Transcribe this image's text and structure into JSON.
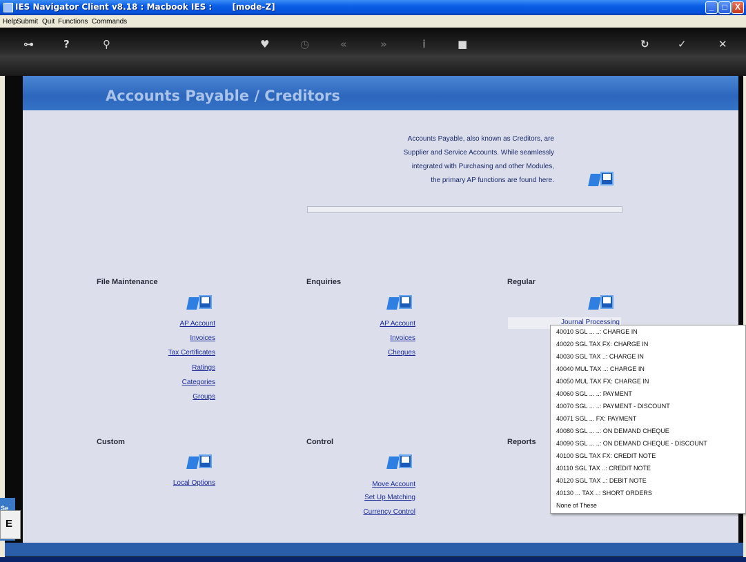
{
  "window": {
    "title": "IES Navigator Client v8.18 : Macbook IES :       [mode-Z]",
    "controls": [
      "_",
      "□",
      "X"
    ]
  },
  "menubar": [
    "Help",
    "Submit",
    "Quit",
    "Functions",
    "Commands"
  ],
  "toolbar": {
    "icons": [
      "key-icon",
      "help-icon",
      "search-icon",
      "heart-icon",
      "clock-icon",
      "rewind-icon",
      "forward-icon",
      "info-icon",
      "stop-icon",
      "refresh-icon",
      "ok-icon",
      "cancel-icon"
    ],
    "glyphs": [
      "⊶",
      "?",
      "⚲",
      "♥",
      "◷",
      "«",
      "»",
      "i",
      "■",
      "↻",
      "✓",
      "✕"
    ]
  },
  "page": {
    "title": "Accounts Payable / Creditors",
    "intro": [
      "Accounts Payable, also known as Creditors, are",
      "Supplier and Service Accounts. While seamlessly",
      "integrated with Purchasing and other Modules,",
      "the primary AP functions are found here."
    ]
  },
  "sections": {
    "file_maintenance": {
      "title": "File Maintenance",
      "links": [
        "AP Account",
        "Invoices",
        "Tax Certificates",
        "Ratings",
        "Categories",
        "Groups"
      ]
    },
    "enquiries": {
      "title": "Enquiries",
      "links": [
        "AP Account",
        "Invoices",
        "Cheques"
      ]
    },
    "regular": {
      "title": "Regular",
      "links": [
        "Journal Processing"
      ]
    },
    "custom": {
      "title": "Custom",
      "links": [
        "Local Options"
      ]
    },
    "control": {
      "title": "Control",
      "links": [
        "Move Account",
        "Set Up Matching",
        "Currency Control"
      ]
    },
    "reports": {
      "title": "Reports"
    }
  },
  "context_menu": {
    "items": [
      "40010 SGL ... ..: CHARGE IN",
      "40020 SGL TAX FX: CHARGE IN",
      "40030 SGL TAX ..: CHARGE IN",
      "40040 MUL TAX ..: CHARGE IN",
      "40050 MUL TAX FX: CHARGE IN",
      "40060 SGL ... ..: PAYMENT",
      "40070 SGL ... ..: PAYMENT - DISCOUNT",
      "40071 SGL ... FX: PAYMENT",
      "40080 SGL ... ..: ON DEMAND CHEQUE",
      "40090 SGL ... ..: ON DEMAND CHEQUE - DISCOUNT",
      "40100 SGL TAX FX: CREDIT NOTE",
      "40110 SGL TAX ..: CREDIT NOTE",
      "40120 SGL TAX ..: DEBIT NOTE",
      "40130 ... TAX ..: SHORT ORDERS",
      "None of These"
    ]
  },
  "side": {
    "tab_label": "Se",
    "panel_label": "E"
  }
}
